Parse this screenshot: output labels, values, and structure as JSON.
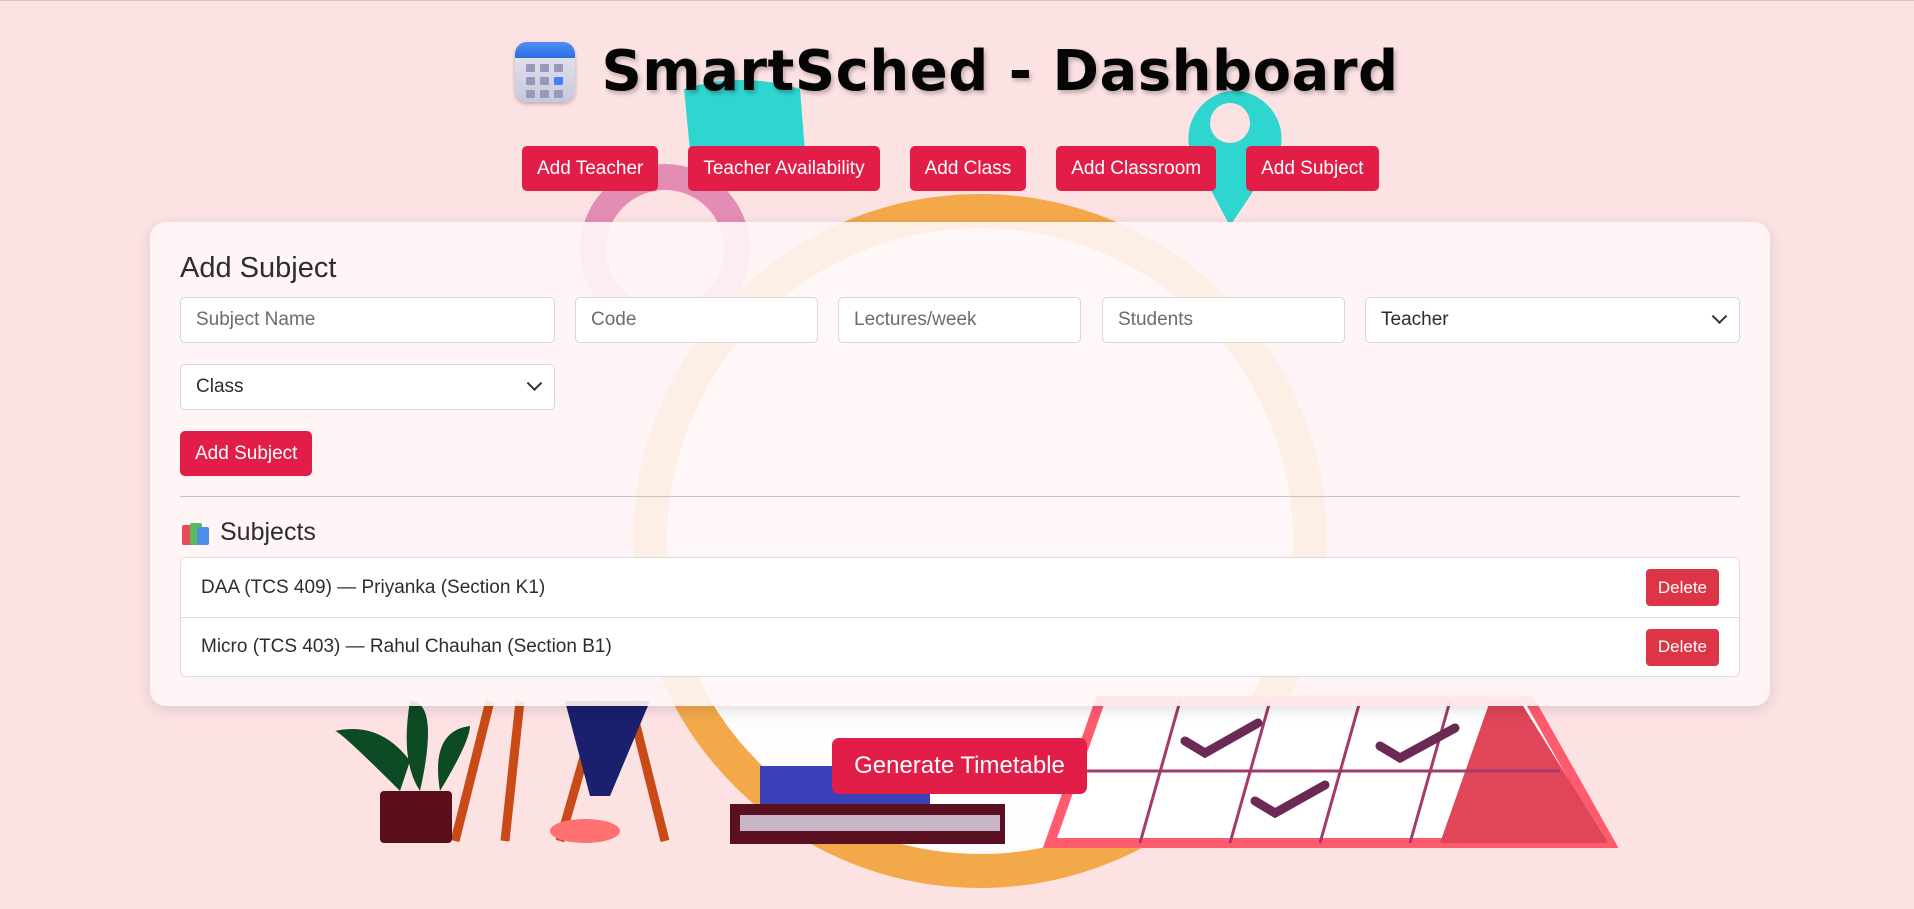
{
  "header": {
    "title": "SmartSched - Dashboard",
    "icon": "calendar-icon"
  },
  "nav": {
    "buttons": [
      "Add Teacher",
      "Teacher Availability",
      "Add Class",
      "Add Classroom",
      "Add Subject"
    ]
  },
  "form": {
    "title": "Add Subject",
    "subject_name_placeholder": "Subject Name",
    "code_placeholder": "Code",
    "lectures_placeholder": "Lectures/week",
    "students_placeholder": "Students",
    "teacher_select": "Teacher",
    "class_select": "Class",
    "submit_label": "Add Subject"
  },
  "subjects": {
    "heading": "Subjects",
    "icon": "books-icon",
    "items": [
      {
        "text": "DAA (TCS 409) — Priyanka (Section K1)",
        "delete_label": "Delete"
      },
      {
        "text": "Micro (TCS 403) — Rahul Chauhan (Section B1)",
        "delete_label": "Delete"
      }
    ]
  },
  "generate_label": "Generate Timetable",
  "colors": {
    "background": "#fde2e4",
    "accent": "#e11d48",
    "danger": "#dc3545"
  }
}
